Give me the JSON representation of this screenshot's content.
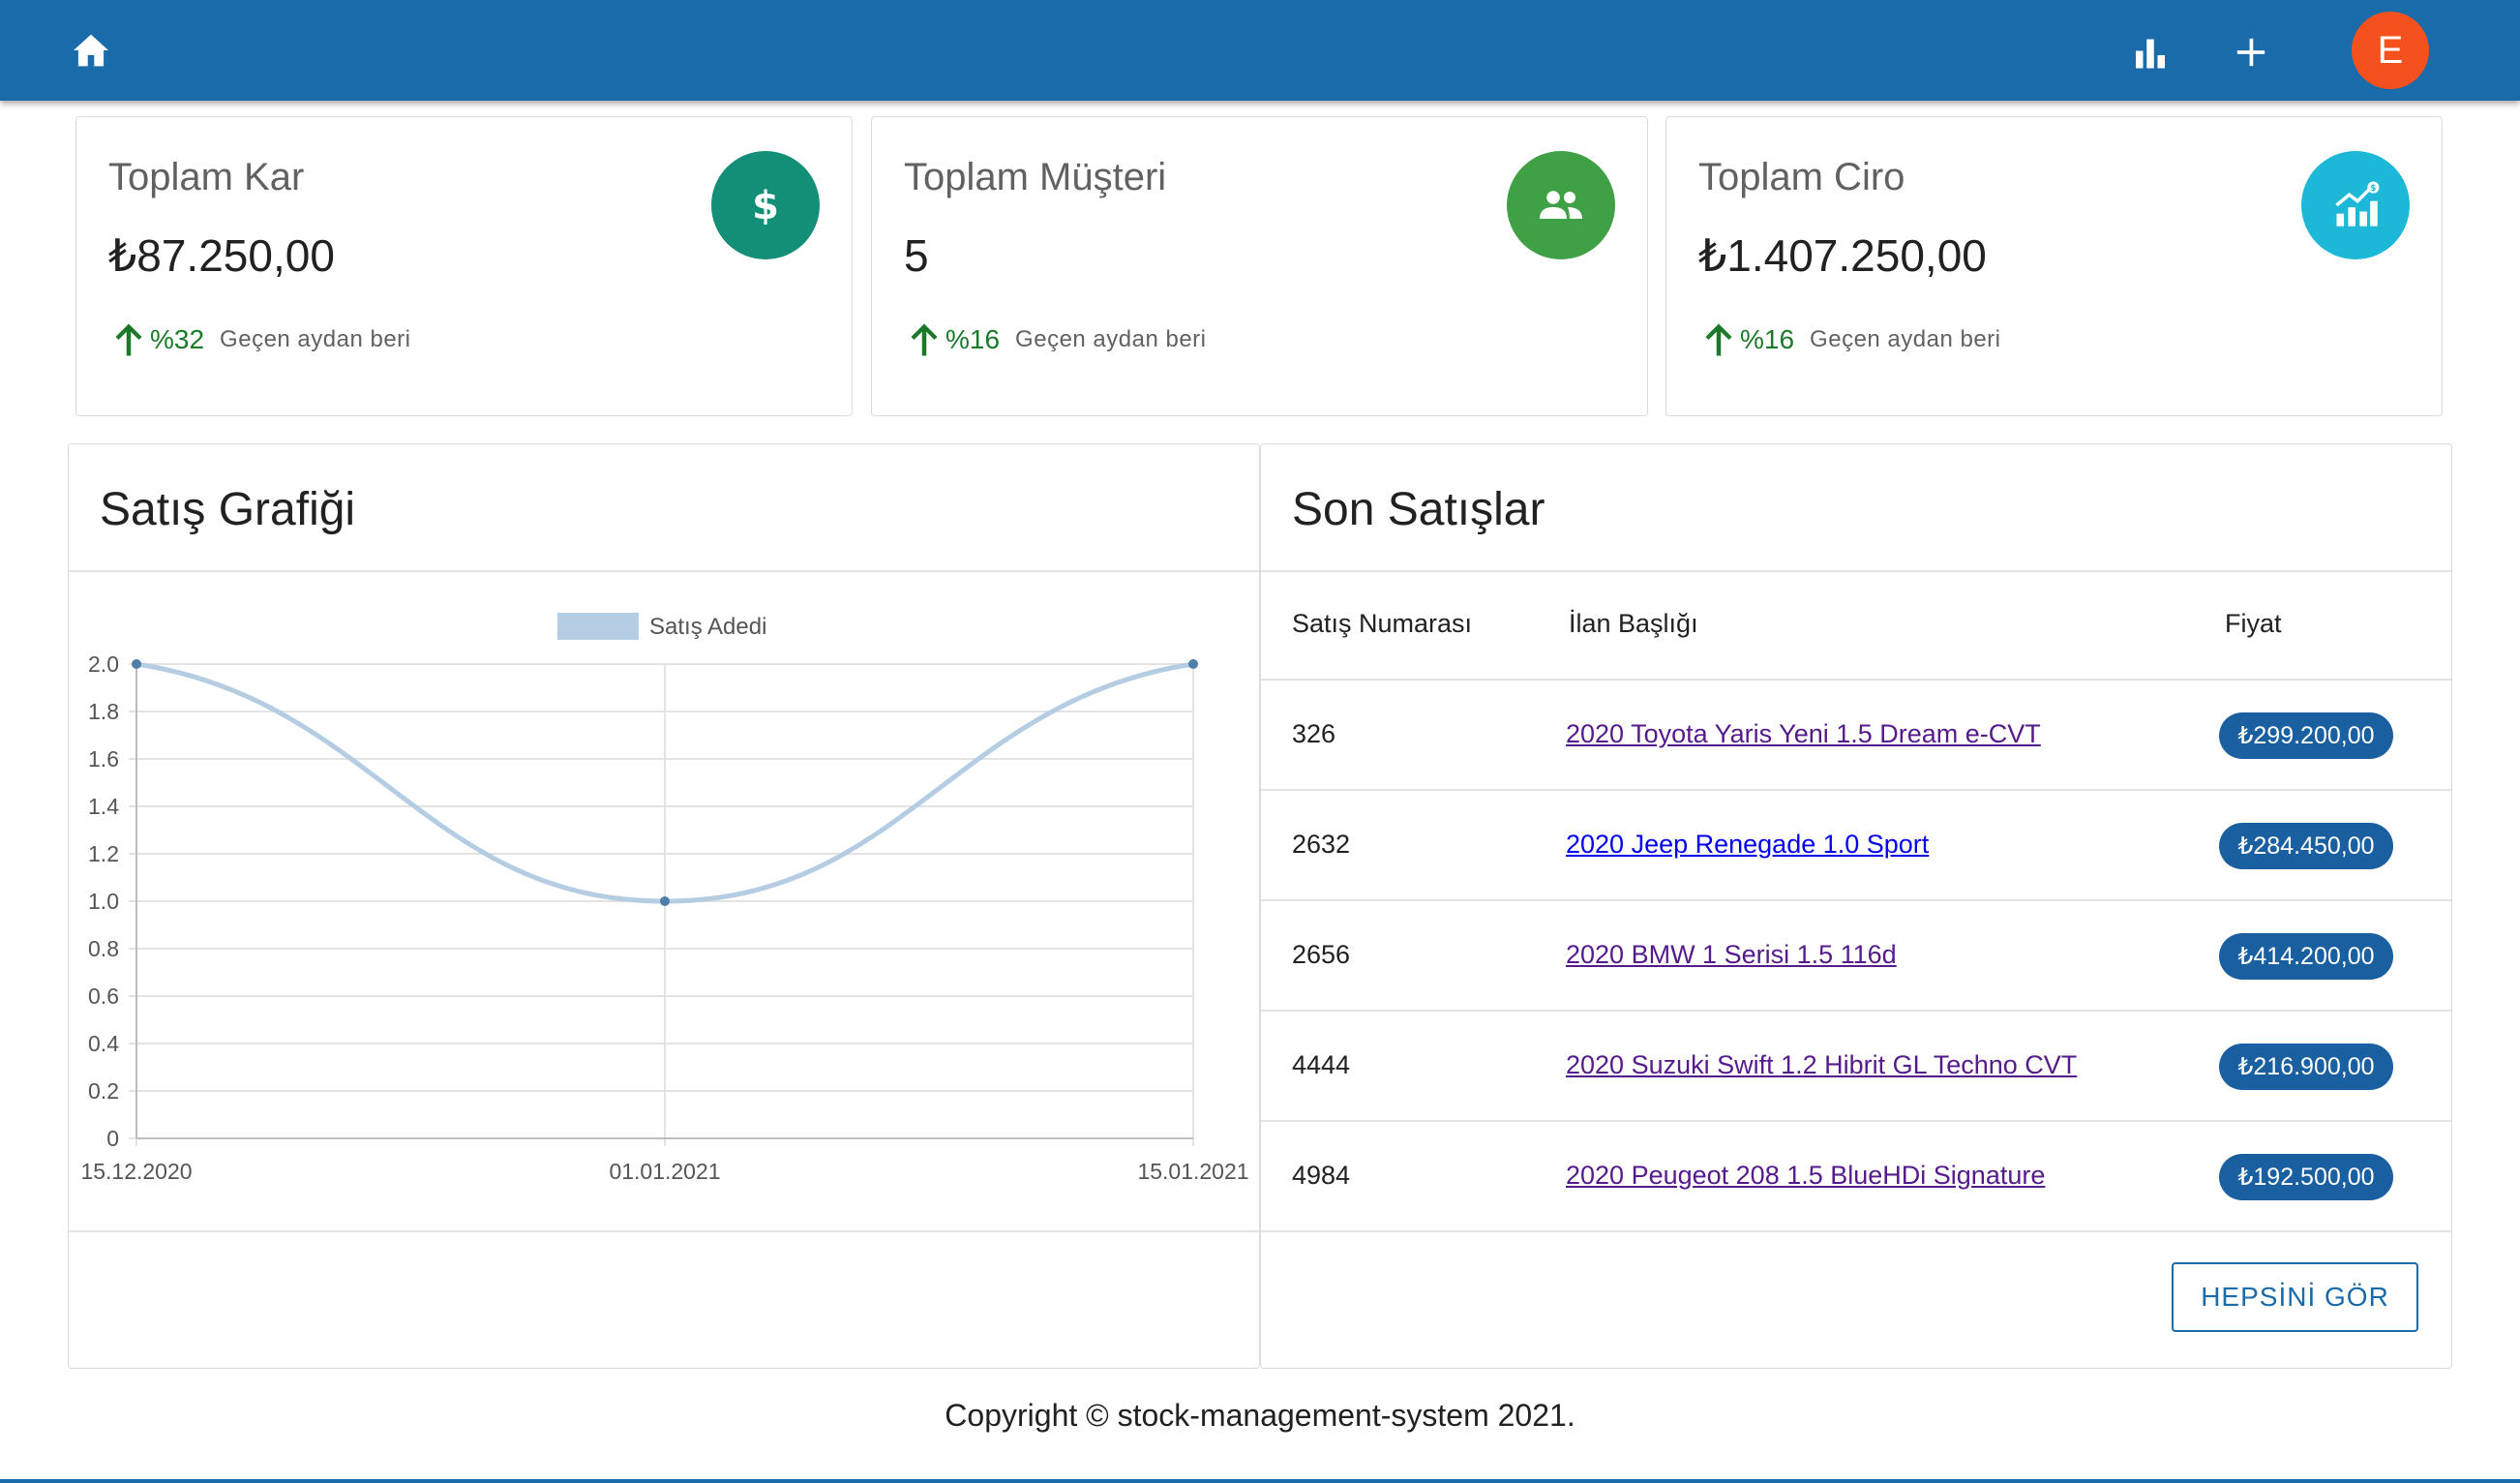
{
  "appbar": {
    "color": "#1a6baa",
    "home_icon": "home-icon",
    "chart_icon": "bar-chart-icon",
    "add_icon": "plus-icon",
    "avatar_letter": "E",
    "avatar_color": "#f4511e"
  },
  "stats": [
    {
      "title": "Toplam Kar",
      "value": "₺87.250,00",
      "change": "%32",
      "since": "Geçen aydan beri",
      "icon": "dollar-icon",
      "icon_color": "#148f77"
    },
    {
      "title": "Toplam Müşteri",
      "value": "5",
      "change": "%16",
      "since": "Geçen aydan beri",
      "icon": "people-icon",
      "icon_color": "#3fa046"
    },
    {
      "title": "Toplam Ciro",
      "value": "₺1.407.250,00",
      "change": "%16",
      "since": "Geçen aydan beri",
      "icon": "growth-chart-icon",
      "icon_color": "#1db8d8"
    }
  ],
  "chart_panel": {
    "title": "Satış Grafiği"
  },
  "chart_data": {
    "type": "line",
    "x": [
      "15.12.2020",
      "01.01.2021",
      "15.01.2021"
    ],
    "series": [
      {
        "name": "Satış Adedi",
        "values": [
          2,
          1,
          2
        ]
      }
    ],
    "yticks": [
      "0",
      "0.2",
      "0.4",
      "0.6",
      "0.8",
      "1.0",
      "1.2",
      "1.4",
      "1.6",
      "1.8",
      "2.0"
    ],
    "ylim": [
      0,
      2
    ],
    "grid": true,
    "legend": "top-center",
    "line_color": "#b4cde3",
    "point_color": "#4f7fa8"
  },
  "sales_panel": {
    "title": "Son Satışlar",
    "headers": [
      "Satış Numarası",
      "İlan Başlığı",
      "Fiyat"
    ],
    "rows": [
      {
        "number": "326",
        "title": "2020 Toyota Yaris Yeni 1.5 Dream e-CVT",
        "price": "₺299.200,00",
        "visited": true
      },
      {
        "number": "2632",
        "title": "2020 Jeep Renegade 1.0 Sport",
        "price": "₺284.450,00",
        "visited": false
      },
      {
        "number": "2656",
        "title": "2020 BMW 1 Serisi 1.5 116d",
        "price": "₺414.200,00",
        "visited": true
      },
      {
        "number": "4444",
        "title": "2020 Suzuki Swift 1.2 Hibrit GL Techno CVT",
        "price": "₺216.900,00",
        "visited": true
      },
      {
        "number": "4984",
        "title": "2020 Peugeot 208 1.5 BlueHDi Signature",
        "price": "₺192.500,00",
        "visited": true
      }
    ],
    "see_all_label": "HEPSİNİ GÖR"
  },
  "footer": {
    "text": "Copyright © stock-management-system 2021."
  }
}
